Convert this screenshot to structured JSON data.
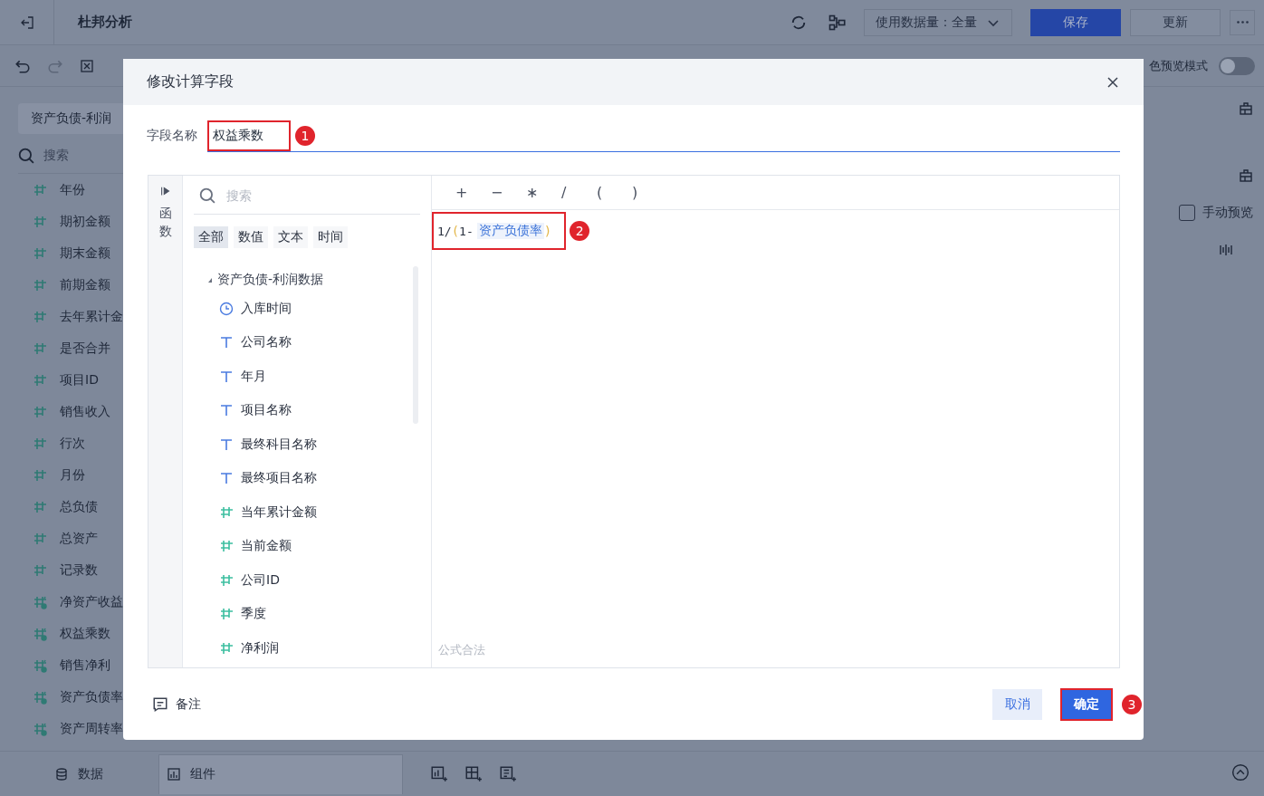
{
  "top_bar": {
    "title": "杜邦分析",
    "data_usage": "使用数据量：全量",
    "buttons": [
      {
        "label": "保存",
        "kind": "primary"
      },
      {
        "label": "更新",
        "kind": "default"
      }
    ]
  },
  "toolbar": {
    "preview_label": "色预览模式",
    "preview_on": false
  },
  "sidebar": {
    "tab": "资产负债-利润",
    "search_placeholder": "搜索",
    "fields": [
      {
        "name": "年份",
        "kind": "number"
      },
      {
        "name": "期初金额",
        "kind": "number"
      },
      {
        "name": "期末金额",
        "kind": "number"
      },
      {
        "name": "前期金额",
        "kind": "number"
      },
      {
        "name": "去年累计金",
        "kind": "number"
      },
      {
        "name": "是否合并",
        "kind": "number"
      },
      {
        "name": "项目ID",
        "kind": "number"
      },
      {
        "name": "销售收入",
        "kind": "number"
      },
      {
        "name": "行次",
        "kind": "number"
      },
      {
        "name": "月份",
        "kind": "number"
      },
      {
        "name": "总负债",
        "kind": "number"
      },
      {
        "name": "总资产",
        "kind": "number"
      },
      {
        "name": "记录数",
        "kind": "count"
      },
      {
        "name": "净资产收益",
        "kind": "calc"
      },
      {
        "name": "权益乘数",
        "kind": "calc"
      },
      {
        "name": "销售净利",
        "kind": "calc"
      },
      {
        "name": "资产负债率",
        "kind": "calc"
      },
      {
        "name": "资产周转率",
        "kind": "calc"
      }
    ]
  },
  "right_panel": {
    "manual_preview": {
      "label": "手动预览",
      "checked": false
    }
  },
  "bottom_bar": {
    "tabs": [
      {
        "label": "数据",
        "selected": false
      },
      {
        "label": "组件",
        "selected": true
      }
    ]
  },
  "dialog": {
    "title": "修改计算字段",
    "field_label": "字段名称",
    "field_value": "权益乘数",
    "side_label": "函数",
    "search_placeholder": "搜索",
    "filters": [
      {
        "label": "全部",
        "selected": true
      },
      {
        "label": "数值",
        "selected": false
      },
      {
        "label": "文本",
        "selected": false
      },
      {
        "label": "时间",
        "selected": false
      }
    ],
    "tree": {
      "label": "资产负债-利润数据",
      "expanded": true,
      "children": [
        {
          "label": "入库时间",
          "kind": "time"
        },
        {
          "label": "公司名称",
          "kind": "text"
        },
        {
          "label": "年月",
          "kind": "text"
        },
        {
          "label": "项目名称",
          "kind": "text"
        },
        {
          "label": "最终科目名称",
          "kind": "text"
        },
        {
          "label": "最终项目名称",
          "kind": "text"
        },
        {
          "label": "当年累计金额",
          "kind": "number"
        },
        {
          "label": "当前金额",
          "kind": "number"
        },
        {
          "label": "公司ID",
          "kind": "number"
        },
        {
          "label": "季度",
          "kind": "number"
        },
        {
          "label": "净利润",
          "kind": "number"
        }
      ]
    },
    "operators": [
      "+",
      "−",
      "∗",
      "/",
      "(",
      ")"
    ],
    "formula": [
      {
        "kind": "text",
        "text": "1/"
      },
      {
        "kind": "paren",
        "text": "("
      },
      {
        "kind": "text",
        "text": "1-"
      },
      {
        "kind": "field",
        "text": "资产负债率"
      },
      {
        "kind": "paren",
        "text": ")"
      }
    ],
    "status": "公式合法",
    "note": "备注",
    "cancel": "取消",
    "confirm": "确定",
    "markers": [
      "1",
      "2",
      "3"
    ]
  }
}
